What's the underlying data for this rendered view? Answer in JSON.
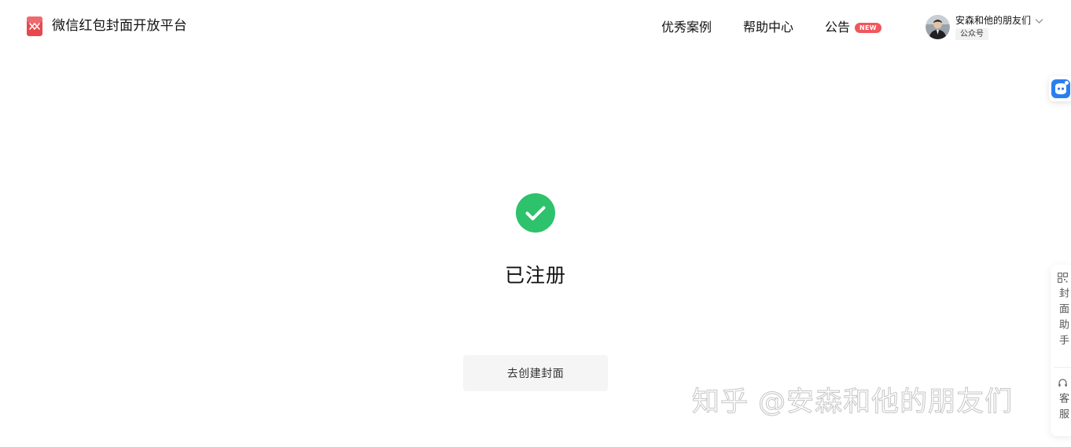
{
  "header": {
    "brand_name": "微信红包封面开放平台",
    "nav": {
      "cases": "优秀案例",
      "help": "帮助中心",
      "announcement": "公告",
      "new_badge": "NEW"
    },
    "account": {
      "name": "安森和他的朋友们",
      "type": "公众号"
    }
  },
  "side_panel": {
    "helper_label": "封面助手",
    "service_label": "客服"
  },
  "main": {
    "status_title": "已注册",
    "create_button": "去创建封面"
  },
  "watermark": "知乎 @安森和他的朋友们",
  "colors": {
    "brand_red": "#e8484d",
    "success_green": "#2dc26b",
    "badge_red": "#f0575c",
    "bot_blue": "#2a7ff0"
  },
  "icons": {
    "brand": "red-envelope-logo",
    "success": "check-circle-icon",
    "chevron": "chevron-down-icon",
    "bot": "assistant-bot-icon",
    "helper": "qrcode-icon",
    "service": "headset-icon"
  }
}
